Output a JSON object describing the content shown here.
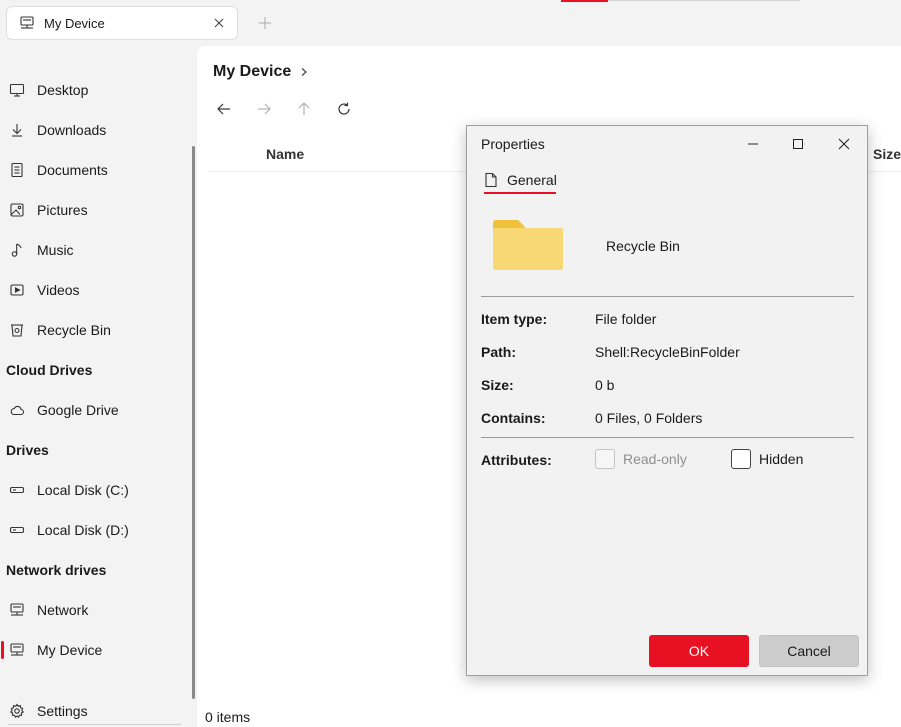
{
  "colors": {
    "accent": "#e81123",
    "folder": "#f8d775",
    "folder_tab": "#f0c23b"
  },
  "tab": {
    "title": "My Device",
    "icon": "network-pc-icon"
  },
  "sidebar": {
    "items": [
      {
        "label": "Desktop",
        "icon": "desktop-icon"
      },
      {
        "label": "Downloads",
        "icon": "download-icon"
      },
      {
        "label": "Documents",
        "icon": "document-icon"
      },
      {
        "label": "Pictures",
        "icon": "picture-icon"
      },
      {
        "label": "Music",
        "icon": "music-icon"
      },
      {
        "label": "Videos",
        "icon": "video-icon"
      },
      {
        "label": "Recycle Bin",
        "icon": "recycle-bin-icon"
      }
    ],
    "cloud_heading": "Cloud Drives",
    "cloud_items": [
      {
        "label": "Google Drive",
        "icon": "cloud-icon"
      }
    ],
    "drives_heading": "Drives",
    "drive_items": [
      {
        "label": "Local Disk (C:)",
        "icon": "drive-icon"
      },
      {
        "label": "Local Disk (D:)",
        "icon": "drive-icon"
      }
    ],
    "network_heading": "Network drives",
    "network_items": [
      {
        "label": "Network",
        "icon": "network-icon"
      },
      {
        "label": "My Device",
        "icon": "network-pc-icon",
        "selected": true
      }
    ],
    "settings_label": "Settings"
  },
  "main": {
    "breadcrumb": "My Device",
    "columns": {
      "name": "Name",
      "size": "Size"
    },
    "status": "0 items"
  },
  "dialog": {
    "title": "Properties",
    "tab_label": "General",
    "item_name": "Recycle Bin",
    "props": [
      {
        "label": "Item type:",
        "value": "File folder"
      },
      {
        "label": "Path:",
        "value": "Shell:RecycleBinFolder"
      },
      {
        "label": "Size:",
        "value": "0 b"
      },
      {
        "label": "Contains:",
        "value": "0 Files, 0 Folders"
      }
    ],
    "attributes_label": "Attributes:",
    "readonly_label": "Read-only",
    "hidden_label": "Hidden",
    "ok_label": "OK",
    "cancel_label": "Cancel"
  }
}
